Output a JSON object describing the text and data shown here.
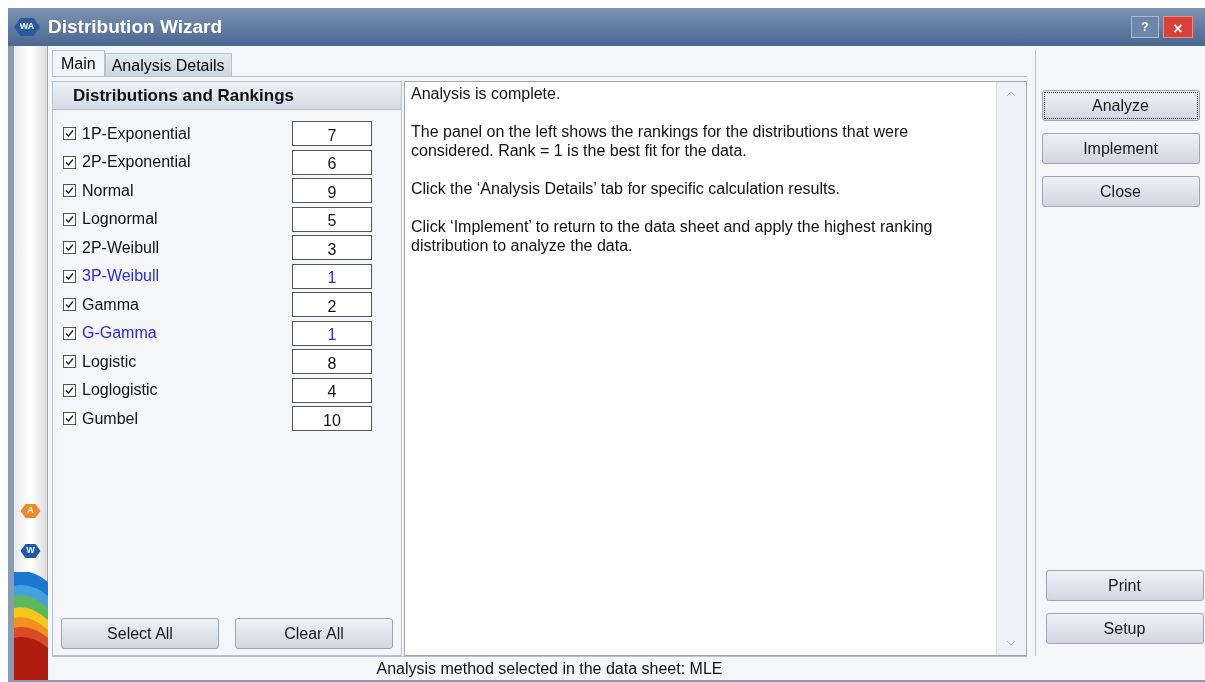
{
  "window": {
    "logo": "WA",
    "title": "Distribution Wizard",
    "help_button": "?",
    "close_button": "×"
  },
  "side_icons": [
    "A",
    "W"
  ],
  "tabs": [
    {
      "label": "Main",
      "selected": true
    },
    {
      "label": "Analysis Details",
      "selected": false
    }
  ],
  "rankings": {
    "header": "Distributions and Rankings",
    "items": [
      {
        "name": "1P-Exponential",
        "checked": true,
        "rank": "7",
        "highlighted": false
      },
      {
        "name": "2P-Exponential",
        "checked": true,
        "rank": "6",
        "highlighted": false
      },
      {
        "name": "Normal",
        "checked": true,
        "rank": "9",
        "highlighted": false
      },
      {
        "name": "Lognormal",
        "checked": true,
        "rank": "5",
        "highlighted": false
      },
      {
        "name": "2P-Weibull",
        "checked": true,
        "rank": "3",
        "highlighted": false
      },
      {
        "name": "3P-Weibull",
        "checked": true,
        "rank": "1",
        "highlighted": true
      },
      {
        "name": "Gamma",
        "checked": true,
        "rank": "2",
        "highlighted": false
      },
      {
        "name": "G-Gamma",
        "checked": true,
        "rank": "1",
        "highlighted": true
      },
      {
        "name": "Logistic",
        "checked": true,
        "rank": "8",
        "highlighted": false
      },
      {
        "name": "Loglogistic",
        "checked": true,
        "rank": "4",
        "highlighted": false
      },
      {
        "name": "Gumbel",
        "checked": true,
        "rank": "10",
        "highlighted": false
      }
    ],
    "buttons": [
      "Select All",
      "Clear All"
    ]
  },
  "results": {
    "paragraphs": [
      "Analysis is complete.",
      "The panel on the left shows the rankings for the distributions that were considered. Rank = 1 is the best fit for the data.",
      "Click the ‘Analysis Details’ tab for specific calculation results.",
      "Click ‘Implement’ to return to the data sheet and apply the highest ranking distribution to analyze the data."
    ]
  },
  "actions_top": [
    {
      "label": "Analyze",
      "focused": true
    },
    {
      "label": "Implement",
      "focused": false
    },
    {
      "label": "Close",
      "focused": false
    }
  ],
  "actions_bottom": [
    "Print",
    "Setup"
  ],
  "status_bar": "Analysis method selected in the data sheet: MLE"
}
